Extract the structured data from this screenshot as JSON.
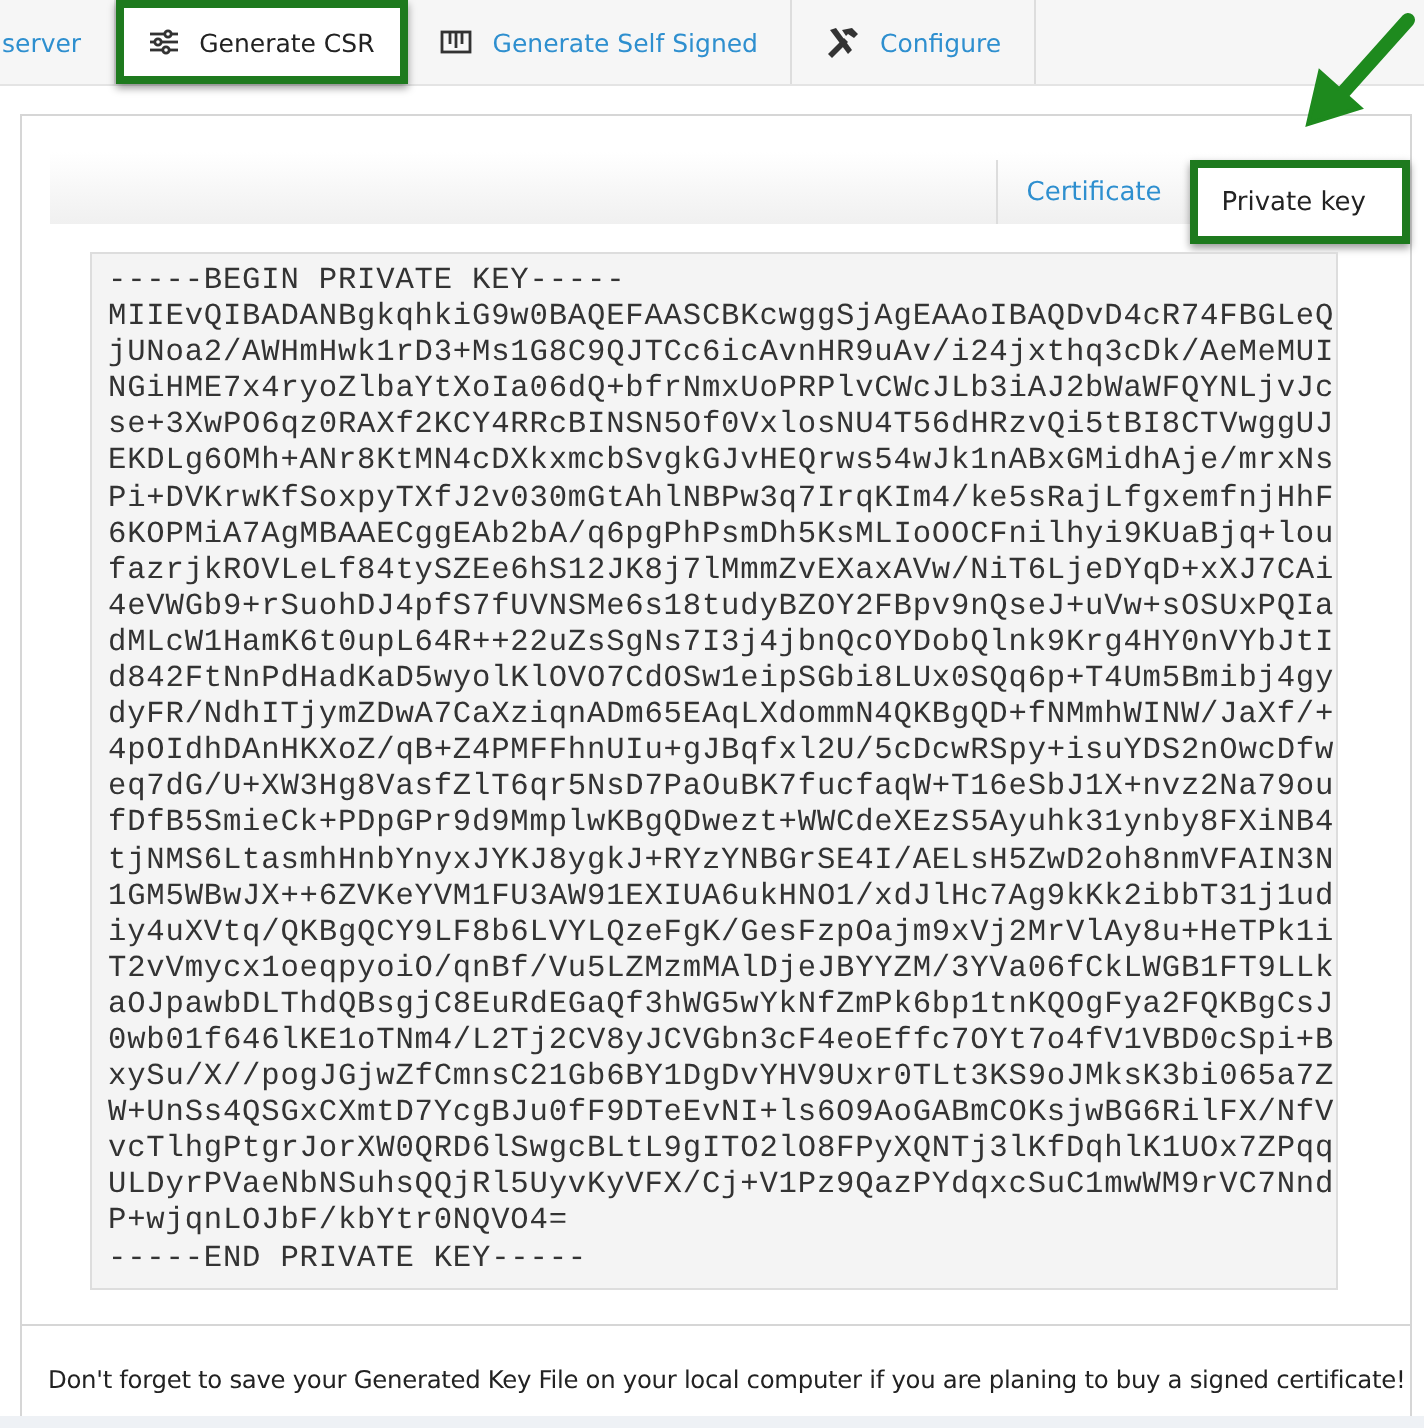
{
  "top_tabs": [
    {
      "label": "server",
      "selected": false,
      "highlighted": false
    },
    {
      "label": "Generate CSR",
      "selected": true,
      "highlighted": true
    },
    {
      "label": "Generate Self Signed",
      "selected": false,
      "highlighted": false
    },
    {
      "label": "Configure",
      "selected": false,
      "highlighted": false
    }
  ],
  "sub_tabs": [
    {
      "label": "Certificate",
      "selected": false,
      "highlighted": false
    },
    {
      "label": "Private key",
      "selected": true,
      "highlighted": true
    }
  ],
  "key_lines": [
    "-----BEGIN PRIVATE KEY-----",
    "MIIEvQIBADANBgkqhkiG9w0BAQEFAASCBKcwggSjAgEAAoIBAQDvD4cR74FBGLeQ",
    "jUNoa2/AWHmHwk1rD3+Ms1G8C9QJTCc6icAvnHR9uAv/i24jxthq3cDk/AeMeMUI",
    "NGiHME7x4ryoZlbaYtXoIa06dQ+bfrNmxUoPRPlvCWcJLb3iAJ2bWaWFQYNLjvJc",
    "se+3XwPO6qz0RAXf2KCY4RRcBINSN5Of0VxlosNU4T56dHRzvQi5tBI8CTVwggUJ",
    "EKDLg6OMh+ANr8KtMN4cDXkxmcbSvgkGJvHEQrws54wJk1nABxGMidhAje/mrxNs",
    "Pi+DVKrwKfSoxpyTXfJ2v030mGtAhlNBPw3q7IrqKIm4/ke5sRajLfgxemfnjHhF",
    "6KOPMiA7AgMBAAECggEAb2bA/q6pgPhPsmDh5KsMLIoOOCFnilhyi9KUaBjq+lou",
    "fazrjkROVLeLf84tySZEe6hS12JK8j7lMmmZvEXaxAVw/NiT6LjeDYqD+xXJ7CAi",
    "4eVWGb9+rSuohDJ4pfS7fUVNSMe6s18tudyBZOY2FBpv9nQseJ+uVw+sOSUxPQIa",
    "dMLcW1HamK6t0upL64R++22uZsSgNs7I3j4jbnQcOYDobQlnk9Krg4HY0nVYbJtI",
    "d842FtNnPdHadKaD5wyolKlOVO7CdOSw1eipSGbi8LUx0SQq6p+T4Um5Bmibj4gy",
    "dyFR/NdhITjymZDwA7CaXziqnADm65EAqLXdommN4QKBgQD+fNMmhWINW/JaXf/+",
    "4pOIdhDAnHKXoZ/qB+Z4PMFFhnUIu+gJBqfxl2U/5cDcwRSpy+isuYDS2nOwcDfw",
    "eq7dG/U+XW3Hg8VasfZlT6qr5NsD7PaOuBK7fucfaqW+T16eSbJ1X+nvz2Na79ou",
    "fDfB5SmieCk+PDpGPr9d9MmplwKBgQDwezt+WWCdeXEzS5Ayuhk31ynby8FXiNB4",
    "tjNMS6LtasmhHnbYnyxJYKJ8ygkJ+RYzYNBGrSE4I/AELsH5ZwD2oh8nmVFAIN3N",
    "1GM5WBwJX++6ZVKeYVM1FU3AW91EXIUA6ukHNO1/xdJlHc7Ag9kKk2ibbT31j1ud",
    "iy4uXVtq/QKBgQCY9LF8b6LVYLQzeFgK/GesFzpOajm9xVj2MrVlAy8u+HeTPk1i",
    "T2vVmycx1oeqpyoiO/qnBf/Vu5LZMzmMAlDjeJBYYZM/3YVa06fCkLWGB1FT9LLk",
    "aOJpawbDLThdQBsgjC8EuRdEGaQf3hWG5wYkNfZmPk6bp1tnKQOgFya2FQKBgCsJ",
    "0wb01f646lKE1oTNm4/L2Tj2CV8yJCVGbn3cF4eoEffc7OYt7o4fV1VBD0cSpi+B",
    "xySu/X//pogJGjwZfCmnsC21Gb6BY1DgDvYHV9Uxr0TLt3KS9oJMksK3bi065a7Z",
    "W+UnSs4QSGxCXmtD7YcgBJu0fF9DTeEvNI+ls6O9AoGABmCOKsjwBG6RilFX/NfV",
    "vcTlhgPtgrJorXW0QRD6lSwgcBLtL9gITO2lO8FPyXQNTj3lKfDqhlK1UOx7ZPqq",
    "ULDyrPVaeNbNSuhsQQjRl5UyvKyVFX/Cj+V1Pz9QazPYdqxcSuC1mwWM9rVC7Nnd",
    "P+wjqnLOJbF/kbYtr0NQVO4=",
    "-----END PRIVATE KEY-----"
  ],
  "footer_note": "Don't forget to save your Generated Key File on your local computer if you are planing to buy a signed certificate!"
}
